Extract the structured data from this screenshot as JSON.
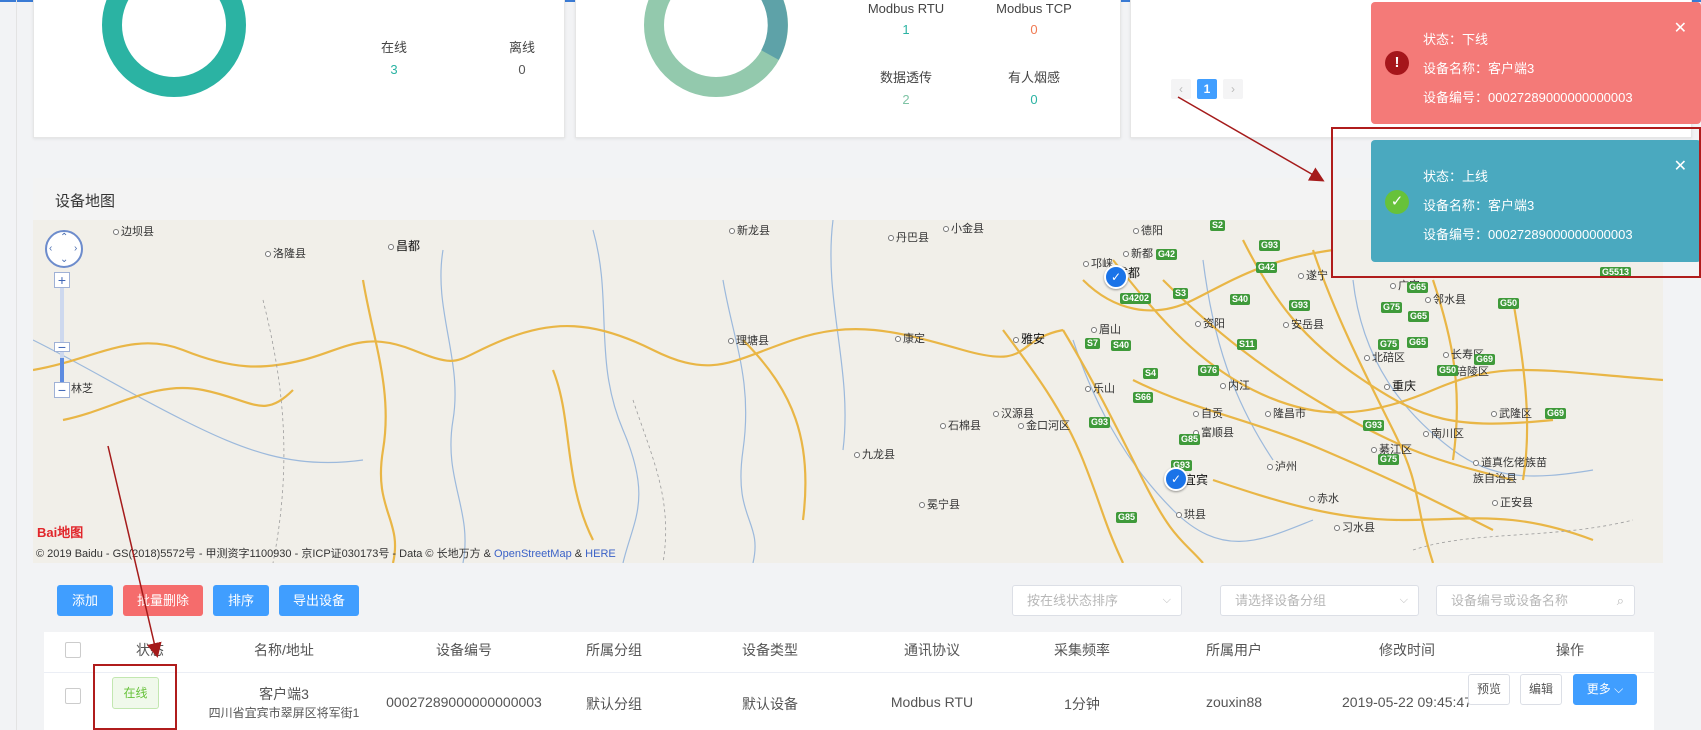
{
  "status_card": {
    "online_label": "在线",
    "online_value": "3",
    "offline_label": "离线",
    "offline_value": "0"
  },
  "protocol_card": {
    "items": [
      {
        "label": "Modbus RTU",
        "value": "1",
        "color": "#2bb3a3"
      },
      {
        "label": "Modbus TCP",
        "value": "0",
        "color": "#f07a52"
      },
      {
        "label": "数据透传",
        "value": "2",
        "color": "#7ec3a5"
      },
      {
        "label": "有人烟感",
        "value": "0",
        "color": "#2bb3a3"
      }
    ]
  },
  "pager": {
    "prev": "‹",
    "current": "1",
    "next": "›"
  },
  "map": {
    "title": "设备地图",
    "places": [
      "边坝县",
      "洛隆县",
      "昌都",
      "新龙县",
      "丹巴县",
      "理塘县",
      "康定",
      "雅安",
      "九龙县",
      "石棉县",
      "汉源县",
      "金口河区",
      "冕宁县",
      "德阳",
      "成都",
      "资阳",
      "眉山",
      "乐山",
      "内江",
      "自贡",
      "富顺县",
      "隆昌市",
      "泸州",
      "宜宾",
      "珙县",
      "遂宁",
      "安岳县",
      "广安",
      "邻水县",
      "北碚区",
      "重庆",
      "长寿区",
      "涪陵区",
      "南川区",
      "武隆区",
      "綦江区",
      "道真仡佬族苗族自治县",
      "正安县",
      "习水县",
      "赤水",
      "邛崃",
      "新都",
      "林芝",
      "小金县"
    ],
    "highways": [
      "S2",
      "G42",
      "G93",
      "G42",
      "G4202",
      "S3",
      "S40",
      "G93",
      "G75",
      "G65",
      "G50",
      "S7",
      "S40",
      "S11",
      "G75",
      "G65",
      "S4",
      "G76",
      "G50",
      "G69",
      "S66",
      "G93",
      "G85",
      "G93",
      "G75",
      "G93",
      "G85",
      "G5513",
      "G65",
      "G69"
    ],
    "copyright": "© 2019 Baidu - GS(2018)5572号 - 甲测资字1100930 - 京ICP证030173号 - Data © 长地万方 &",
    "copyright_osm": "OpenStreetMap",
    "copyright_amp": "&",
    "copyright_here": "HERE",
    "logo": "Bai地图"
  },
  "toolbar": {
    "add": "添加",
    "batch_delete": "批量删除",
    "sort": "排序",
    "export": "导出设备",
    "sort_select_placeholder": "按在线状态排序",
    "group_select_placeholder": "请选择设备分组",
    "search_placeholder": "设备编号或设备名称"
  },
  "table": {
    "headers": [
      "状态",
      "名称/地址",
      "设备编号",
      "所属分组",
      "设备类型",
      "通讯协议",
      "采集频率",
      "所属用户",
      "修改时间",
      "操作"
    ],
    "row": {
      "status": "在线",
      "name": "客户端3",
      "address": "四川省宜宾市翠屏区将军街1",
      "device_no": "00027289000000000003",
      "group": "默认分组",
      "type": "默认设备",
      "protocol": "Modbus RTU",
      "frequency": "1分钟",
      "user": "zouxin88",
      "modified": "2019-05-22 09:45:47",
      "preview": "预览",
      "edit": "编辑",
      "more": "更多"
    }
  },
  "toasts": [
    {
      "kind": "error",
      "status": "状态：下线",
      "name": "设备名称：客户端3",
      "number": "设备编号：00027289000000000003",
      "bg": "#f47a78"
    },
    {
      "kind": "success",
      "status": "状态：上线",
      "name": "设备名称：客户端3",
      "number": "设备编号：00027289000000000003",
      "bg": "#4aa9bf"
    }
  ]
}
